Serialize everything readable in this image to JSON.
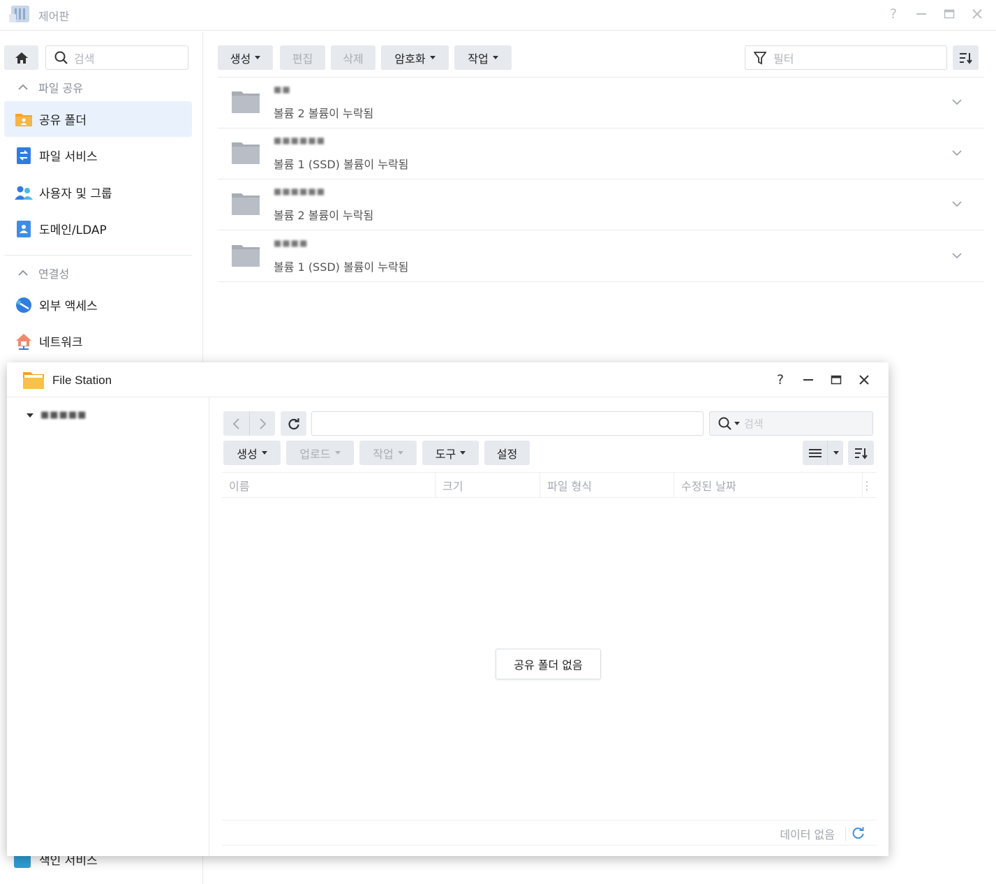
{
  "control_panel": {
    "title": "제어판",
    "search_placeholder": "검색",
    "sections": [
      {
        "label": "파일 공유"
      },
      {
        "label": "연결성"
      }
    ],
    "sidebar_items": [
      {
        "label": "공유 폴더",
        "icon": "shared-folder-icon"
      },
      {
        "label": "파일 서비스",
        "icon": "file-services-icon"
      },
      {
        "label": "사용자 및 그룹",
        "icon": "users-groups-icon"
      },
      {
        "label": "도메인/LDAP",
        "icon": "domain-ldap-icon"
      },
      {
        "label": "외부 액세스",
        "icon": "external-access-icon"
      },
      {
        "label": "네트워크",
        "icon": "network-icon"
      }
    ],
    "hidden_item": {
      "label": "색인 서비스",
      "icon": "indexing-service-icon"
    },
    "toolbar": {
      "create": "생성",
      "edit": "편집",
      "delete": "삭제",
      "encryption": "암호화",
      "action": "작업",
      "filter_placeholder": "필터"
    },
    "folders": [
      {
        "name": "■■",
        "status": "볼륨 2 볼륨이 누락됨"
      },
      {
        "name": "■■■■■■",
        "status": "볼륨 1 (SSD) 볼륨이 누락됨"
      },
      {
        "name": "■■■■■■",
        "status": "볼륨 2 볼륨이 누락됨"
      },
      {
        "name": "■■■■",
        "status": "볼륨 1 (SSD) 볼륨이 누락됨"
      }
    ],
    "colors": {
      "accent": "#e9f1fc",
      "folder_gray": "#a7adb5"
    }
  },
  "file_station": {
    "title": "File Station",
    "tree_root": "■■■■■",
    "search_placeholder": "검색",
    "path_value": "",
    "toolbar": {
      "create": "생성",
      "upload": "업로드",
      "action": "작업",
      "tools": "도구",
      "settings": "설정"
    },
    "columns": [
      "이름",
      "크기",
      "파일 형식",
      "수정된 날짜"
    ],
    "empty_message": "공유 폴더 없음",
    "footer_status": "데이터 없음"
  }
}
